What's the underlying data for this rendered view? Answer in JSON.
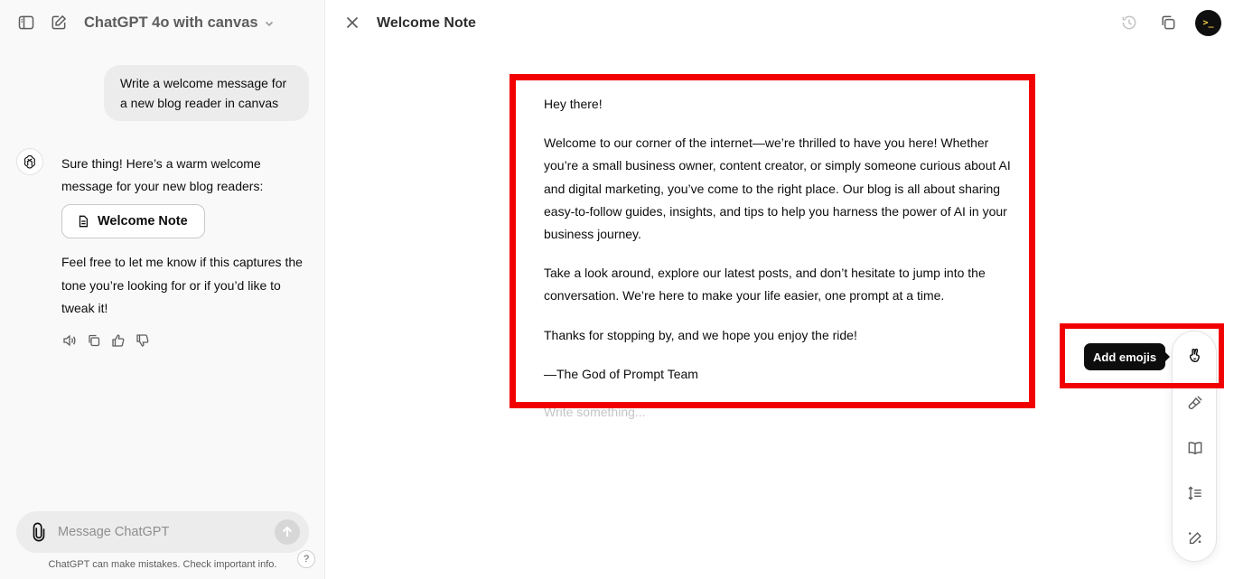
{
  "header": {
    "model_title": "ChatGPT 4o with canvas"
  },
  "chat": {
    "user_message": "Write a welcome message for a new blog reader in canvas",
    "assistant_intro": "Sure thing! Here’s a warm welcome message for your new blog readers:",
    "doc_card_label": "Welcome Note",
    "assistant_followup": "Feel free to let me know if this captures the tone you’re looking for or if you’d like to tweak it!"
  },
  "composer": {
    "placeholder": "Message ChatGPT",
    "disclaimer": "ChatGPT can make mistakes. Check important info.",
    "help_label": "?"
  },
  "canvas": {
    "title": "Welcome Note",
    "paragraphs": [
      "Hey there!",
      "Welcome to our corner of the internet—we’re thrilled to have you here! Whether you’re a small business owner, content creator, or simply someone curious about AI and digital marketing, you’ve come to the right place. Our blog is all about sharing easy-to-follow guides, insights, and tips to help you harness the power of AI in your business journey.",
      "Take a look around, explore our latest posts, and don’t hesitate to jump into the conversation. We’re here to make your life easier, one prompt at a time.",
      "Thanks for stopping by, and we hope you enjoy the ride!",
      "—The God of Prompt Team"
    ],
    "placeholder": "Write something..."
  },
  "tools": {
    "tooltip": "Add emojis",
    "items": [
      "add-emojis",
      "add-final-polish",
      "reading-level",
      "adjust-length",
      "suggest-edits"
    ]
  },
  "avatar_text": ">_",
  "colors": {
    "highlight": "#f20000",
    "sidebar_bg": "#f9f9f9",
    "tooltip_bg": "#0d0d0d"
  }
}
